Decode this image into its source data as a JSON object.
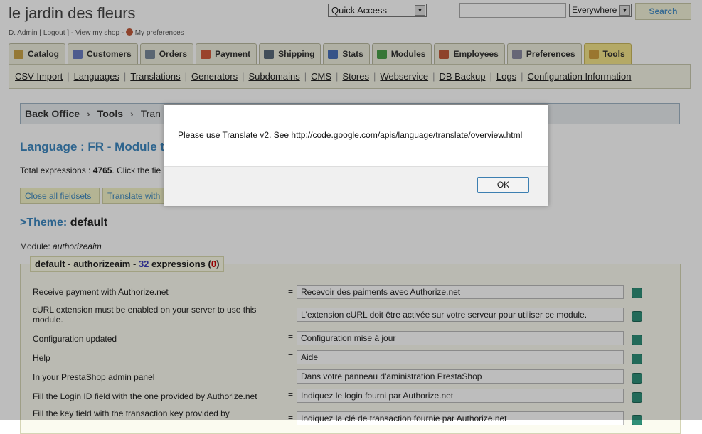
{
  "header": {
    "shop_name": "le jardin des fleurs",
    "user": "D. Admin",
    "logout": "Logout",
    "view_shop": "View my shop",
    "preferences": "My preferences",
    "quick_access": "Quick Access",
    "search_scope": "Everywhere",
    "search_button": "Search",
    "search_value": ""
  },
  "tabs": [
    {
      "label": "Catalog",
      "icon": "catalog-icon",
      "color": "#c9a448"
    },
    {
      "label": "Customers",
      "icon": "customers-icon",
      "color": "#6a7cc0"
    },
    {
      "label": "Orders",
      "icon": "orders-icon",
      "color": "#7a8a9a"
    },
    {
      "label": "Payment",
      "icon": "payment-icon",
      "color": "#d05a3a"
    },
    {
      "label": "Shipping",
      "icon": "shipping-icon",
      "color": "#5a6a7a"
    },
    {
      "label": "Stats",
      "icon": "stats-icon",
      "color": "#4a70b8"
    },
    {
      "label": "Modules",
      "icon": "modules-icon",
      "color": "#4aa04a"
    },
    {
      "label": "Employees",
      "icon": "employees-icon",
      "color": "#c05a3a"
    },
    {
      "label": "Preferences",
      "icon": "preferences-icon",
      "color": "#8a8aa0"
    },
    {
      "label": "Tools",
      "icon": "tools-icon",
      "color": "#d0a040",
      "active": true
    }
  ],
  "subnav": [
    "CSV Import",
    "Languages",
    "Translations",
    "Generators",
    "Subdomains",
    "CMS",
    "Stores",
    "Webservice",
    "DB Backup",
    "Logs",
    "Configuration Information"
  ],
  "breadcrumb": [
    "Back Office",
    "Tools",
    "Tran"
  ],
  "page": {
    "title": "Language : FR - Module tr",
    "total_prefix": "Total expressions : ",
    "total_count": "4765",
    "total_suffix": ". Click the fie",
    "close_all": "Close all fieldsets",
    "translate_with": "Translate with",
    "theme_label": ">Theme:",
    "theme_value": "default",
    "module_prefix": "Module: ",
    "module_name": "authorizeaim"
  },
  "fieldset": {
    "theme": "default",
    "dash": " - ",
    "module": "authorizeaim",
    "dash2": " - ",
    "count": "32",
    "expr": " expressions (",
    "missing": "0",
    "close": ")"
  },
  "rows": [
    {
      "src": "Receive payment with Authorize.net",
      "val": "Recevoir des paiments avec Authorize.net"
    },
    {
      "src": "cURL extension must be enabled on your server to use this module.",
      "val": "L'extension cURL doit être activée sur votre serveur pour utiliser ce module."
    },
    {
      "src": "Configuration updated",
      "val": "Configuration mise à jour"
    },
    {
      "src": "Help",
      "val": "Aide"
    },
    {
      "src": "In your PrestaShop admin panel",
      "val": "Dans votre panneau d'aministration PrestaShop"
    },
    {
      "src": "Fill the Login ID field with the one provided by Authorize.net",
      "val": "Indiquez le login fourni par Authorize.net"
    },
    {
      "src": "Fill the key field with the transaction key provided by",
      "val": "Indiquez la clé de transaction fournie par Authorize.net"
    }
  ],
  "dialog": {
    "message": "Please use Translate v2.  See http://code.google.com/apis/language/translate/overview.html",
    "ok": "OK"
  }
}
